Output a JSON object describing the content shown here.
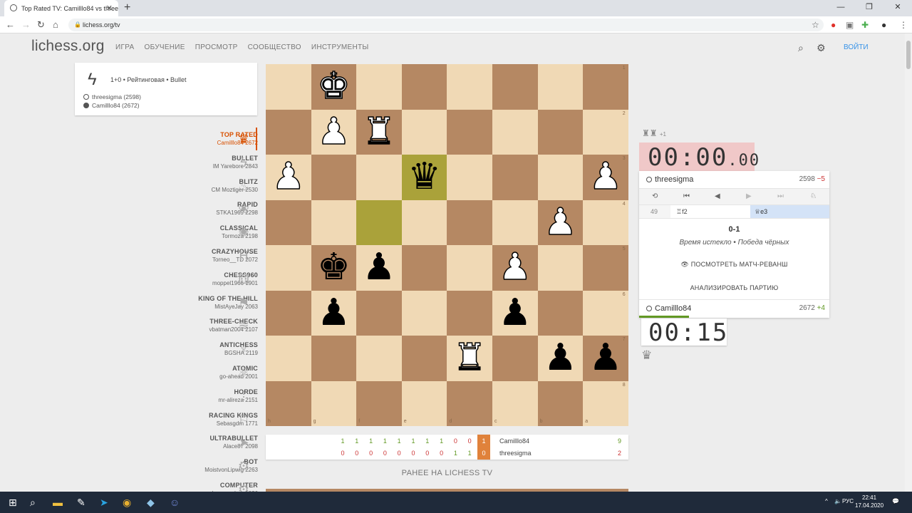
{
  "browser": {
    "tab_title": "Top Rated TV: Camilllo84 vs three",
    "url": "lichess.org/tv",
    "newtab_icon": "+",
    "window_controls": [
      "—",
      "❐",
      "✕"
    ]
  },
  "site": {
    "logo": "lichess.org",
    "nav": [
      "ИГРА",
      "ОБУЧЕНИЕ",
      "ПРОСМОТР",
      "СООБЩЕСТВО",
      "ИНСТРУМЕНТЫ"
    ],
    "login": "ВОЙТИ"
  },
  "game_card": {
    "meta": "1+0 • Рейтинговая • Bullet",
    "white": "threesigma (2598)",
    "black": "Camilllo84 (2672)"
  },
  "channels": [
    {
      "name": "TOP RATED",
      "player": "Camilllo84 2672",
      "icon": "♛",
      "active": true
    },
    {
      "name": "BULLET",
      "player": "IM Yarebore 2843",
      "icon": "ϟ"
    },
    {
      "name": "BLITZ",
      "player": "CM Moztiger 2530",
      "icon": "♨"
    },
    {
      "name": "RAPID",
      "player": "STKA1969 2298",
      "icon": "❀"
    },
    {
      "name": "CLASSICAL",
      "player": "Tormoza 2198",
      "icon": "✺"
    },
    {
      "name": "CRAZYHOUSE",
      "player": "Torneo__TD 2072",
      "icon": "H"
    },
    {
      "name": "CHESS960",
      "player": "moppel1966 1901",
      "icon": "⚅"
    },
    {
      "name": "KING OF THE HILL",
      "player": "MistAyeJay 2063",
      "icon": "⚑"
    },
    {
      "name": "THREE-CHECK",
      "player": "vbatman2004 2107",
      "icon": "≋"
    },
    {
      "name": "ANTICHESS",
      "player": "BGSHA 2119",
      "icon": "♆"
    },
    {
      "name": "ATOMIC",
      "player": "go-ahead 2001",
      "icon": "⚛"
    },
    {
      "name": "HORDE",
      "player": "mr-alireza 2151",
      "icon": "⁞"
    },
    {
      "name": "RACING KINGS",
      "player": "Sebasgdm 1771",
      "icon": "⚐"
    },
    {
      "name": "ULTRABULLET",
      "player": "Alace87 2098",
      "icon": "➤"
    },
    {
      "name": "BOT",
      "player": "MoistvonLipwig 2263",
      "icon": "⚙"
    },
    {
      "name": "COMPUTER",
      "player": "Leo-sandros 1826",
      "icon": "⚙"
    }
  ],
  "board": {
    "files": [
      "h",
      "g",
      "f",
      "e",
      "d",
      "c",
      "b",
      "a"
    ],
    "ranks": [
      "1",
      "2",
      "3",
      "4",
      "5",
      "6",
      "7",
      "8"
    ],
    "highlights": [
      [
        2,
        3
      ],
      [
        3,
        2
      ]
    ],
    "pieces": [
      {
        "r": 0,
        "c": 1,
        "glyph": "♚",
        "color": "w"
      },
      {
        "r": 1,
        "c": 1,
        "glyph": "♟",
        "color": "w"
      },
      {
        "r": 1,
        "c": 2,
        "glyph": "♜",
        "color": "w"
      },
      {
        "r": 2,
        "c": 0,
        "glyph": "♟",
        "color": "w"
      },
      {
        "r": 2,
        "c": 3,
        "glyph": "♛",
        "color": "b"
      },
      {
        "r": 2,
        "c": 7,
        "glyph": "♟",
        "color": "w"
      },
      {
        "r": 3,
        "c": 6,
        "glyph": "♟",
        "color": "w"
      },
      {
        "r": 4,
        "c": 1,
        "glyph": "♚",
        "color": "b"
      },
      {
        "r": 4,
        "c": 2,
        "glyph": "♟",
        "color": "b"
      },
      {
        "r": 4,
        "c": 5,
        "glyph": "♟",
        "color": "w"
      },
      {
        "r": 5,
        "c": 1,
        "glyph": "♟",
        "color": "b"
      },
      {
        "r": 5,
        "c": 5,
        "glyph": "♟",
        "color": "b"
      },
      {
        "r": 6,
        "c": 4,
        "glyph": "♜",
        "color": "w"
      },
      {
        "r": 6,
        "c": 6,
        "glyph": "♟",
        "color": "b"
      },
      {
        "r": 6,
        "c": 7,
        "glyph": "♟",
        "color": "b"
      }
    ]
  },
  "panel": {
    "captured": "♜♜",
    "captured_diff": "+1",
    "top_clock": {
      "main": "00:00",
      "ms": ".00"
    },
    "top_player": {
      "name": "threesigma",
      "rating": "2598",
      "diff": "−5"
    },
    "controls": [
      "⟲",
      "⏮",
      "◀",
      "▶",
      "⏭",
      "♘"
    ],
    "move": {
      "num": "49",
      "white": "♖f2",
      "black": "♕e3"
    },
    "result": "0-1",
    "status": "Время истекло • Победа чёрных",
    "rematch_label": "ПОСМОТРЕТЬ МАТЧ-РЕВАНШ",
    "analyze_label": "АНАЛИЗИРОВАТЬ ПАРТИЮ",
    "bottom_player": {
      "name": "Camilllo84",
      "rating": "2672",
      "diff": "+4"
    },
    "bottom_clock": "00:15",
    "bottom_crown": "♛"
  },
  "score": {
    "row1": [
      "1",
      "1",
      "1",
      "1",
      "1",
      "1",
      "1",
      "1",
      "0",
      "0"
    ],
    "row2": [
      "0",
      "0",
      "0",
      "0",
      "0",
      "0",
      "0",
      "0",
      "1",
      "1"
    ],
    "current": [
      "1",
      "0"
    ],
    "names": [
      "Camilllo84",
      "threesigma"
    ],
    "totals": [
      "9",
      "2"
    ]
  },
  "earlier": "РАНЕЕ НА LICHESS TV",
  "taskbar": {
    "lang": "РУС",
    "time": "22:41",
    "date": "17.04.2020"
  }
}
